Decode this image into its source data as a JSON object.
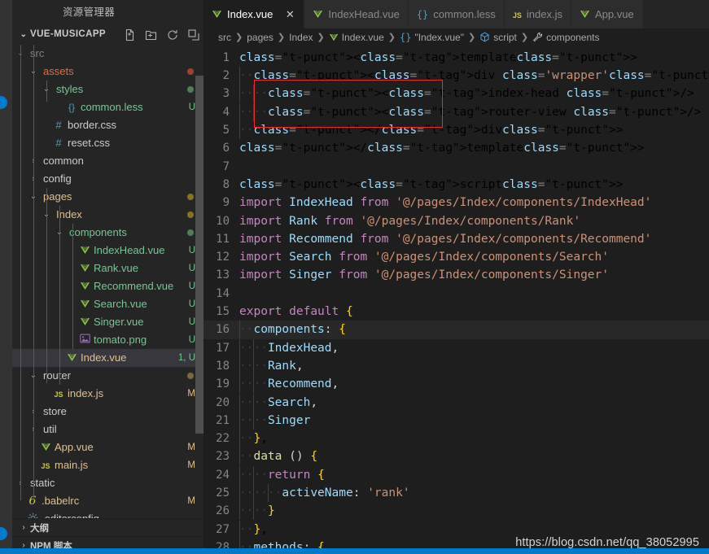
{
  "window": {
    "explorer_title": "资源管理器",
    "accent_color": "#007acc",
    "editor_bg": "#1e1e1e",
    "sidebar_bg": "#252526",
    "highlight_box_color": "#ef2929"
  },
  "sidebar": {
    "project_name": "VUE-MUSICAPP",
    "project_chevron": "⌄",
    "actions": [
      {
        "name": "new-file-icon",
        "title": "新建文件"
      },
      {
        "name": "new-folder-icon",
        "title": "新建文件夹"
      },
      {
        "name": "refresh-icon",
        "title": "刷新"
      },
      {
        "name": "collapse-all-icon",
        "title": "折叠文件夹"
      }
    ],
    "tree": [
      {
        "label": "src",
        "indent": 1,
        "type": "folder",
        "twisty": "⌄",
        "status": "",
        "color": "c-white",
        "cut": true
      },
      {
        "label": "assets",
        "indent": 2,
        "type": "folder",
        "twisty": "⌄",
        "status": "",
        "color": "c-orange",
        "dot": "#a04030"
      },
      {
        "label": "styles",
        "indent": 3,
        "type": "folder",
        "twisty": "⌄",
        "status": "",
        "color": "c-green",
        "dot": "#4d8055"
      },
      {
        "label": "common.less",
        "indent": 4,
        "type": "less",
        "icon": "{}",
        "status": "U",
        "color": "c-green"
      },
      {
        "label": "border.css",
        "indent": 3,
        "type": "css",
        "icon": "#",
        "status": "",
        "color": "c-white"
      },
      {
        "label": "reset.css",
        "indent": 3,
        "type": "css",
        "icon": "#",
        "status": "",
        "color": "c-white"
      },
      {
        "label": "common",
        "indent": 2,
        "type": "folder",
        "twisty": "›",
        "status": "",
        "color": "c-white"
      },
      {
        "label": "config",
        "indent": 2,
        "type": "folder",
        "twisty": "›",
        "status": "",
        "color": "c-white"
      },
      {
        "label": "pages",
        "indent": 2,
        "type": "folder",
        "twisty": "⌄",
        "status": "",
        "color": "c-yellow",
        "dot": "#8a7220"
      },
      {
        "label": "Index",
        "indent": 3,
        "type": "folder",
        "twisty": "⌄",
        "status": "",
        "color": "c-yellow",
        "dot": "#8a7220"
      },
      {
        "label": "components",
        "indent": 4,
        "type": "folder",
        "twisty": "⌄",
        "status": "",
        "color": "c-green",
        "dot": "#4d8055"
      },
      {
        "label": "IndexHead.vue",
        "indent": 5,
        "type": "vue",
        "status": "U",
        "color": "c-green"
      },
      {
        "label": "Rank.vue",
        "indent": 5,
        "type": "vue",
        "status": "U",
        "color": "c-green"
      },
      {
        "label": "Recommend.vue",
        "indent": 5,
        "type": "vue",
        "status": "U",
        "color": "c-green"
      },
      {
        "label": "Search.vue",
        "indent": 5,
        "type": "vue",
        "status": "U",
        "color": "c-green"
      },
      {
        "label": "Singer.vue",
        "indent": 5,
        "type": "vue",
        "status": "U",
        "color": "c-green"
      },
      {
        "label": "tomato.png",
        "indent": 5,
        "type": "image",
        "status": "U",
        "color": "c-green"
      },
      {
        "label": "Index.vue",
        "indent": 4,
        "type": "vue",
        "status": "1, U",
        "color": "c-yellow",
        "selected": true
      },
      {
        "label": "router",
        "indent": 2,
        "type": "folder",
        "twisty": "⌄",
        "status": "",
        "color": "c-white",
        "dot": "#7a6a3a"
      },
      {
        "label": "index.js",
        "indent": 3,
        "type": "js",
        "status": "M",
        "color": "c-yellow"
      },
      {
        "label": "store",
        "indent": 2,
        "type": "folder",
        "twisty": "›",
        "status": "",
        "color": "c-white"
      },
      {
        "label": "util",
        "indent": 2,
        "type": "folder",
        "twisty": "›",
        "status": "",
        "color": "c-white"
      },
      {
        "label": "App.vue",
        "indent": 2,
        "type": "vue",
        "status": "M",
        "color": "c-yellow"
      },
      {
        "label": "main.js",
        "indent": 2,
        "type": "js",
        "status": "M",
        "color": "c-yellow"
      },
      {
        "label": "static",
        "indent": 1,
        "type": "folder",
        "twisty": "›",
        "status": "",
        "color": "c-white"
      },
      {
        "label": ".babelrc",
        "indent": 1,
        "type": "babel",
        "status": "M",
        "color": "c-yellow"
      },
      {
        "label": ".editorconfig",
        "indent": 1,
        "type": "config",
        "status": "",
        "color": "c-white"
      }
    ],
    "bottom_sections": [
      {
        "label": "大纲",
        "chevron": "›"
      },
      {
        "label": "NPM 脚本",
        "chevron": "›"
      }
    ]
  },
  "tabs": [
    {
      "label": "Index.vue",
      "icon": "vue",
      "active": true,
      "close": "✕"
    },
    {
      "label": "IndexHead.vue",
      "icon": "vue",
      "active": false
    },
    {
      "label": "common.less",
      "icon": "less",
      "active": false
    },
    {
      "label": "index.js",
      "icon": "js",
      "active": false
    },
    {
      "label": "App.vue",
      "icon": "vue",
      "active": false
    }
  ],
  "breadcrumb": [
    {
      "label": "src",
      "icon": ""
    },
    {
      "label": "pages",
      "icon": ""
    },
    {
      "label": "Index",
      "icon": ""
    },
    {
      "label": "Index.vue",
      "icon": "vue"
    },
    {
      "label": "\"Index.vue\"",
      "icon": "braces"
    },
    {
      "label": "script",
      "icon": "module"
    },
    {
      "label": "components",
      "icon": "wrench"
    }
  ],
  "editor": {
    "current_line": 16,
    "lines": [
      {
        "n": 1,
        "text": "<template>"
      },
      {
        "n": 2,
        "text": "  <div class='wrapper'>"
      },
      {
        "n": 3,
        "text": "    <index-head />"
      },
      {
        "n": 4,
        "text": "    <router-view />"
      },
      {
        "n": 5,
        "text": "  </div>"
      },
      {
        "n": 6,
        "text": "</template>"
      },
      {
        "n": 7,
        "text": ""
      },
      {
        "n": 8,
        "text": "<script>"
      },
      {
        "n": 9,
        "text": "import IndexHead from '@/pages/Index/components/IndexHead'"
      },
      {
        "n": 10,
        "text": "import Rank from '@/pages/Index/components/Rank'"
      },
      {
        "n": 11,
        "text": "import Recommend from '@/pages/Index/components/Recommend'"
      },
      {
        "n": 12,
        "text": "import Search from '@/pages/Index/components/Search'"
      },
      {
        "n": 13,
        "text": "import Singer from '@/pages/Index/components/Singer'"
      },
      {
        "n": 14,
        "text": ""
      },
      {
        "n": 15,
        "text": "export default {"
      },
      {
        "n": 16,
        "text": "  components: {"
      },
      {
        "n": 17,
        "text": "    IndexHead,"
      },
      {
        "n": 18,
        "text": "    Rank,"
      },
      {
        "n": 19,
        "text": "    Recommend,"
      },
      {
        "n": 20,
        "text": "    Search,"
      },
      {
        "n": 21,
        "text": "    Singer"
      },
      {
        "n": 22,
        "text": "  },"
      },
      {
        "n": 23,
        "text": "  data () {"
      },
      {
        "n": 24,
        "text": "    return {"
      },
      {
        "n": 25,
        "text": "      activeName: 'rank'"
      },
      {
        "n": 26,
        "text": "    }"
      },
      {
        "n": 27,
        "text": "  },"
      },
      {
        "n": 28,
        "text": "  methods: {"
      }
    ]
  },
  "watermark": "https://blog.csdn.net/qq_38052995"
}
